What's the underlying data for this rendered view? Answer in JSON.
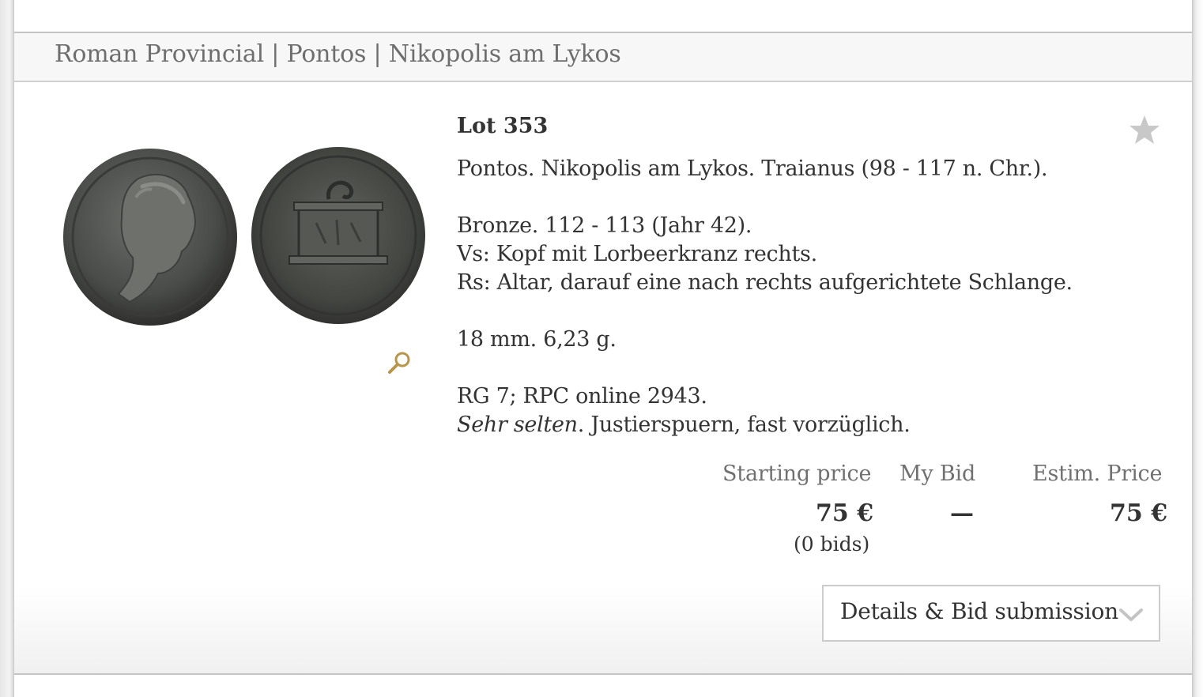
{
  "breadcrumb": "Roman Provincial | Pontos | Nikopolis am Lykos",
  "lot": {
    "title": "Lot 353",
    "favorite_icon": "star-icon",
    "zoom_icon": "magnifier-icon",
    "description": {
      "heading": "Pontos. Nikopolis am Lykos. Traianus (98 - 117 n. Chr.).",
      "denomination": "Bronze. 112 - 113 (Jahr 42).",
      "obverse": "Vs: Kopf mit Lorbeerkranz rechts.",
      "reverse": "Rs: Altar, darauf eine nach rechts aufgerichtete Schlange.",
      "measurements": "18 mm. 6,23 g.",
      "references": "RG 7; RPC online 2943.",
      "rarity": "Sehr selten",
      "condition": ". Justierspuern, fast vorzüglich."
    }
  },
  "pricing": {
    "starting_label": "Starting price",
    "starting_value": "75 €",
    "bids": "(0 bids)",
    "mybid_label": "My Bid",
    "mybid_value": "—",
    "estim_label": "Estim. Price",
    "estim_value": "75 €"
  },
  "details_button": {
    "label": "Details & Bid submission",
    "icon": "chevron-down-icon"
  },
  "colors": {
    "accent_gold": "#b8954a",
    "star_gray": "#c8c8c8",
    "text": "#333333",
    "muted": "#6e6e6e"
  }
}
